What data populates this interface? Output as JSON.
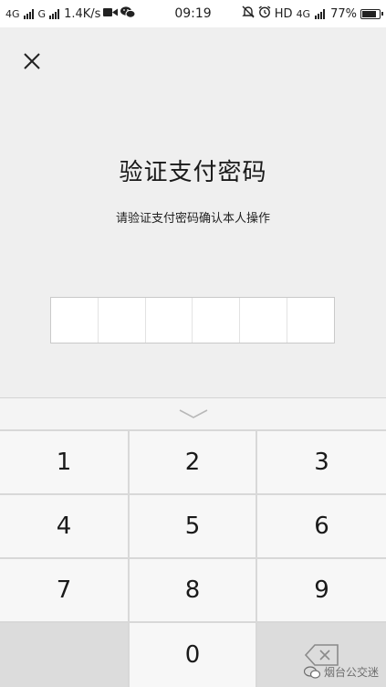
{
  "status_bar": {
    "network1": "4G",
    "network2": "G",
    "speed": "1.4K/s",
    "time": "09:19",
    "hd": "HD",
    "network3": "4G",
    "battery": "77%",
    "battery_level": 0.77
  },
  "header": {
    "close_icon": "close-icon"
  },
  "main": {
    "title": "验证支付密码",
    "subtitle": "请验证支付密码确认本人操作",
    "pin_length": 6
  },
  "keypad": {
    "collapse_icon": "chevron-down-icon",
    "keys": [
      "1",
      "2",
      "3",
      "4",
      "5",
      "6",
      "7",
      "8",
      "9",
      "0"
    ],
    "backspace_icon": "backspace-icon"
  },
  "watermark": {
    "text": "烟台公交迷"
  }
}
